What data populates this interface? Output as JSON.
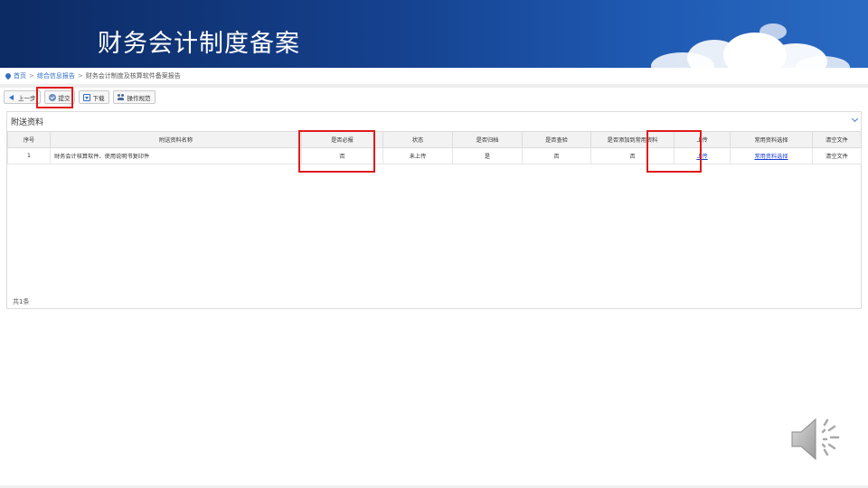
{
  "header": {
    "title": "财务会计制度备案"
  },
  "breadcrumb": {
    "home": "首页",
    "section": "综合信息报告",
    "current": "财务会计制度及核算软件备案报告",
    "separator": ">"
  },
  "toolbar": {
    "prev_label": "上一步",
    "submit_label": "提交",
    "download_label": "下载",
    "guide_label": "操作规范"
  },
  "panel": {
    "title": "附送资料",
    "footer": "共1条"
  },
  "table": {
    "headers": {
      "index": "序号",
      "name": "附送资料名称",
      "required": "是否必报",
      "status": "状态",
      "archived": "是否归档",
      "checked": "是否查验",
      "add_common": "是否添加到常用资料",
      "upload": "上传",
      "common_select": "常用资料选择",
      "clear": "清空文件"
    },
    "rows": [
      {
        "index": "1",
        "name": "财务会计核算软件、使用说明书复印件",
        "required": "否",
        "status": "未上传",
        "archived": "是",
        "checked": "否",
        "add_common": "否",
        "upload": "上传",
        "common_select": "常用资料选择",
        "clear": "清空文件"
      }
    ]
  },
  "colors": {
    "banner_dark": "#0c2a63",
    "banner_light": "#2a6ac2",
    "highlight": "#e01a1a",
    "link": "#1a3fd6"
  }
}
